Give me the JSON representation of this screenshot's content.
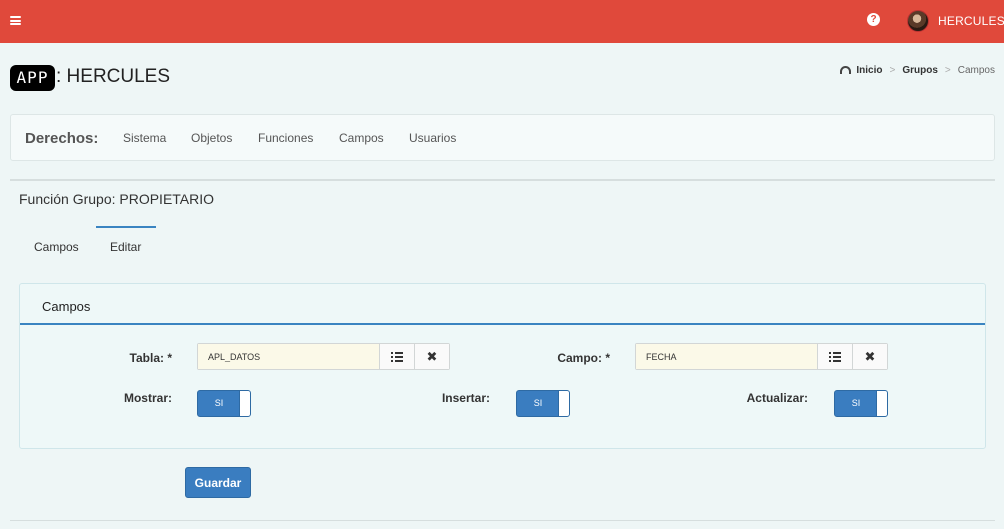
{
  "header": {
    "user_name": "HERCULES",
    "help_glyph": "?",
    "icons": {
      "menu": "hamburger-icon",
      "help": "question-circle-icon",
      "avatar": "user-avatar"
    },
    "color": "#e0493b"
  },
  "app": {
    "logo_text": "APP",
    "title": ": HERCULES"
  },
  "breadcrumb": {
    "items": [
      "Inicio",
      "Grupos",
      "Campos"
    ],
    "separator": ">"
  },
  "rights": {
    "label": "Derechos:",
    "items": [
      "Sistema",
      "Objetos",
      "Funciones",
      "Campos",
      "Usuarios"
    ]
  },
  "function_title": "Función Grupo: PROPIETARIO",
  "tabs": [
    {
      "label": "Campos",
      "active": false
    },
    {
      "label": "Editar",
      "active": true
    }
  ],
  "panel": {
    "title": "Campos",
    "tabla": {
      "label": "Tabla: *",
      "value": "APL_DATOS"
    },
    "campo": {
      "label": "Campo: *",
      "value": "FECHA"
    },
    "toggles": [
      {
        "label": "Mostrar:",
        "value": "SI"
      },
      {
        "label": "Insertar:",
        "value": "SI"
      },
      {
        "label": "Actualizar:",
        "value": "SI"
      }
    ]
  },
  "save_label": "Guardar",
  "colors": {
    "accent": "#3a7dc0",
    "header": "#e0493b",
    "input_bg": "#fbf9e8"
  }
}
